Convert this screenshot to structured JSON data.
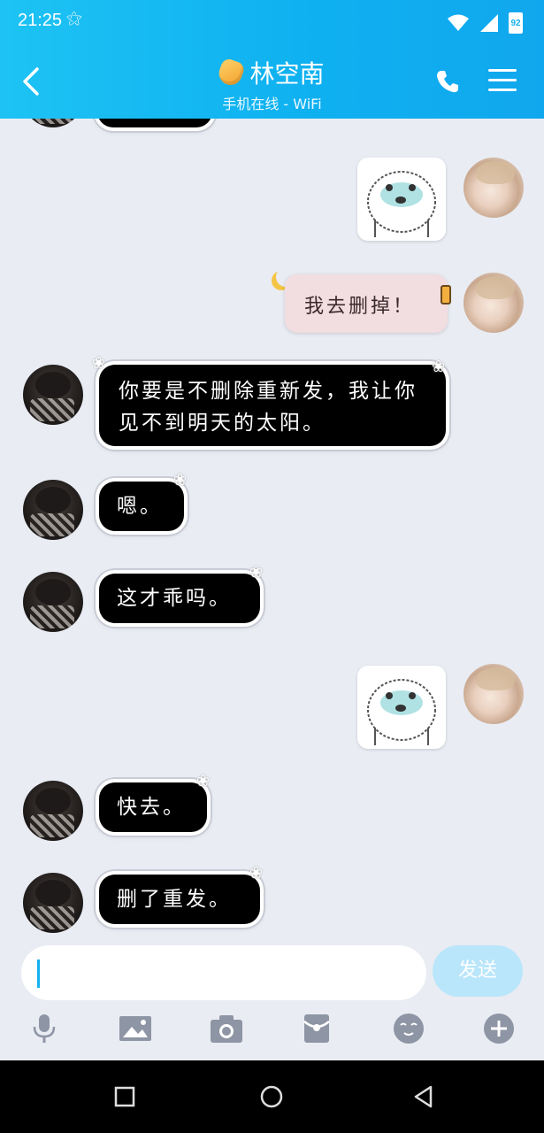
{
  "status_bar": {
    "time": "21:25",
    "battery": "92"
  },
  "header": {
    "contact_name": "林空南",
    "contact_status": "手机在线 - WiFi"
  },
  "messages": [
    {
      "side": "right",
      "type": "sticker",
      "icon": "bear-sticker"
    },
    {
      "side": "right",
      "type": "text",
      "text": "我去删掉！"
    },
    {
      "side": "left",
      "type": "text",
      "text": "你要是不删除重新发，我让你见不到明天的太阳。"
    },
    {
      "side": "left",
      "type": "text",
      "text": "嗯。"
    },
    {
      "side": "left",
      "type": "text",
      "text": "这才乖吗。"
    },
    {
      "side": "right",
      "type": "sticker",
      "icon": "bear-sticker"
    },
    {
      "side": "left",
      "type": "text",
      "text": "快去。"
    },
    {
      "side": "left",
      "type": "text",
      "text": "删了重发。"
    }
  ],
  "input": {
    "value": "",
    "send_label": "发送"
  },
  "toolbar": [
    "microphone-icon",
    "image-icon",
    "camera-icon",
    "red-packet-icon",
    "emoji-icon",
    "plus-icon"
  ],
  "colors": {
    "header": "#12b4f0",
    "background": "#e9ecf3",
    "bubble_dark": "#000000",
    "bubble_pink": "#f2dde1"
  }
}
